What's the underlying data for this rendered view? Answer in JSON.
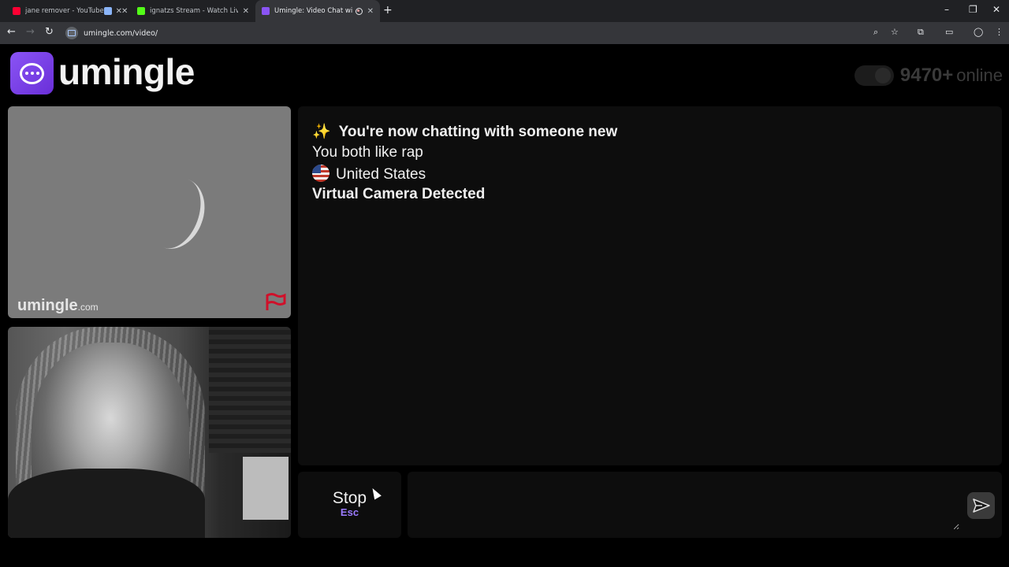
{
  "browser": {
    "tabs": [
      {
        "title": "jane remover - YouTube",
        "favicon_color": "#ff0033"
      },
      {
        "title": "",
        "favicon_color": "#8ab4f8"
      },
      {
        "title": "ignatzs Stream - Watch Live on",
        "favicon_color": "#53fc18"
      },
      {
        "title": "Umingle: Video Chat with S",
        "favicon_color": "#8a54f5"
      }
    ],
    "address": "umingle.com/video/"
  },
  "header": {
    "logo_text": "umingle",
    "online_count": "9470+",
    "online_label": "online"
  },
  "remote_video": {
    "watermark": "umingle",
    "watermark_suffix": ".com"
  },
  "chat": {
    "sparkle": "✨",
    "line1": "You're now chatting with someone new",
    "line2": "You both like rap",
    "country": "United States",
    "line4": "Virtual Camera Detected"
  },
  "controls": {
    "stop_label": "Stop",
    "stop_shortcut": "Esc",
    "message_placeholder": ""
  },
  "colors": {
    "brand": "#7c44ee",
    "accent_shortcut": "#9b7bff"
  }
}
